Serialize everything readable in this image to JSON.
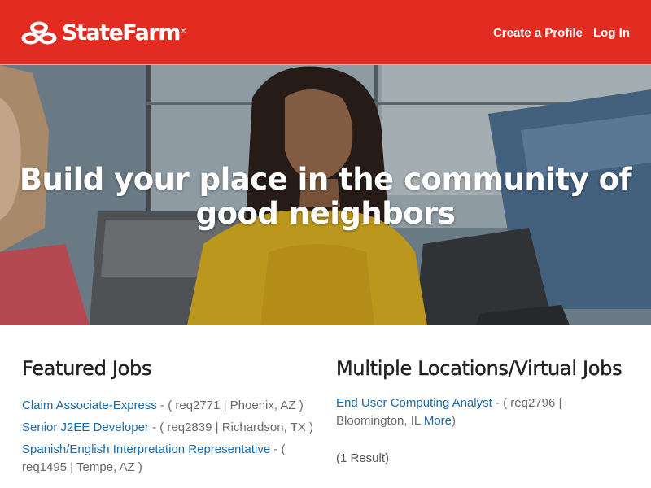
{
  "header": {
    "brand": "StateFarm",
    "brand_mark": "®",
    "nav": [
      {
        "label": "Create a Profile"
      },
      {
        "label": "Log In"
      }
    ]
  },
  "hero": {
    "title_line1": "Build your place in the community of",
    "title_line2": "good neighbors"
  },
  "featured": {
    "heading": "Featured Jobs",
    "jobs": [
      {
        "title": "Claim Associate-Express",
        "details": " - ( req2771 | Phoenix, AZ )"
      },
      {
        "title": "Senior J2EE Developer",
        "details": " - ( req2839 | Richardson, TX )"
      },
      {
        "title": "Spanish/English Interpretation Representative",
        "details": " - ( req1495 | Tempe, AZ )"
      }
    ]
  },
  "multiple": {
    "heading": "Multiple Locations/Virtual Jobs",
    "jobs": [
      {
        "title": "End User Computing Analyst",
        "details": " - ( req2796 | Bloomington, IL ",
        "more": "More",
        "close": ")"
      }
    ],
    "results": "(1 Result)"
  },
  "colors": {
    "brand_red": "#e22c22",
    "link_blue": "#1a6aa8"
  }
}
